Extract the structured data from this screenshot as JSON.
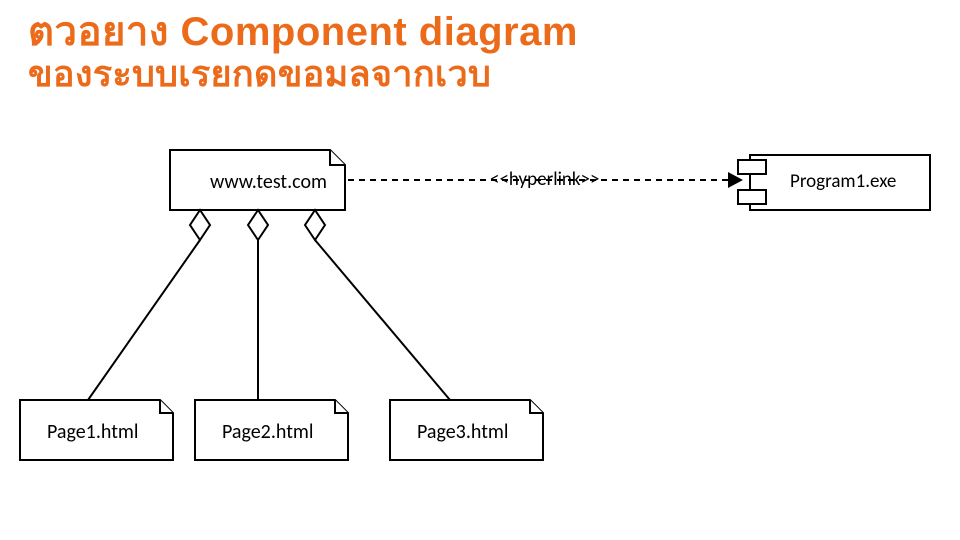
{
  "title": {
    "line1": "ตวอยาง    Component diagram",
    "line2": "ของระบบเรยกดขอมลจากเวบ"
  },
  "artifacts": {
    "root": "www.test.com",
    "page1": "Page1.html",
    "page2": "Page2.html",
    "page3": "Page3.html"
  },
  "dependency_label": "<<hyperlink>>",
  "component": "Program1.exe"
}
